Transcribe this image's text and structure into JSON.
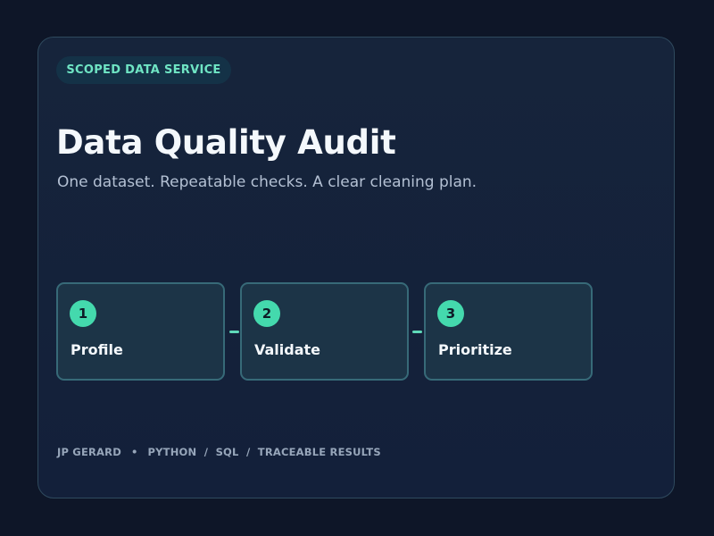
{
  "badge": "SCOPED DATA SERVICE",
  "title": "Data Quality Audit",
  "subtitle": "One dataset. Repeatable checks. A clear cleaning plan.",
  "steps": [
    {
      "number": "1",
      "label": "Profile"
    },
    {
      "number": "2",
      "label": "Validate"
    },
    {
      "number": "3",
      "label": "Prioritize"
    }
  ],
  "footer": {
    "author": "JP GERARD",
    "separator": "•",
    "tags": "PYTHON  /  SQL  /  TRACEABLE RESULTS"
  },
  "colors": {
    "background": "#0e1628",
    "card": "#16243b",
    "accent": "#44d9ad",
    "step_border": "#376a78"
  }
}
